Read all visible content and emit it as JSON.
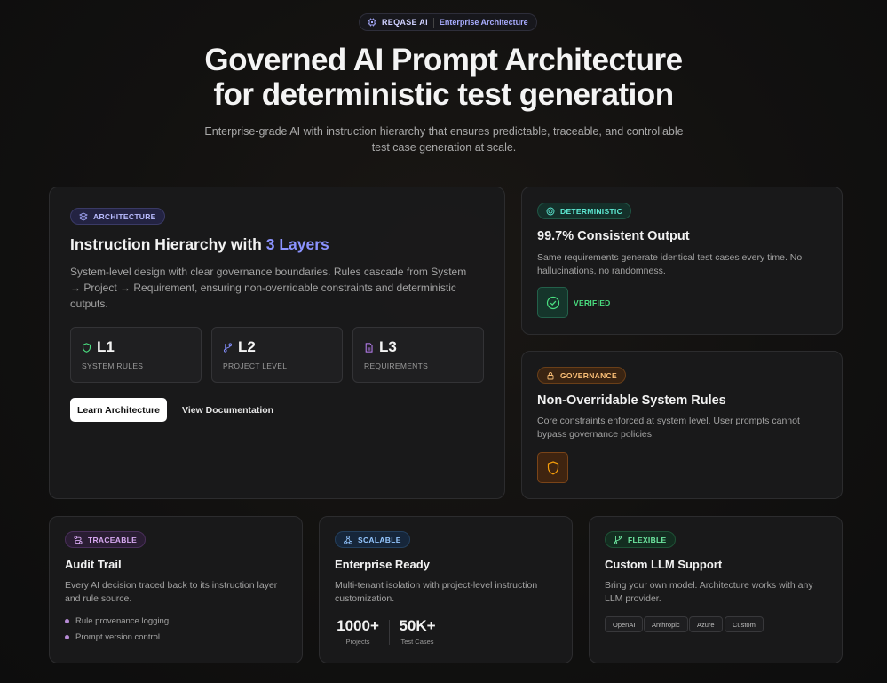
{
  "top_badge": {
    "brand": "REQASE AI",
    "subtitle": "Enterprise Architecture"
  },
  "hero": {
    "title_line1": "Governed AI Prompt Architecture",
    "title_line2": "for deterministic test generation",
    "subtitle": "Enterprise-grade AI with instruction hierarchy that ensures predictable, traceable, and controllable test case generation at scale."
  },
  "architecture_card": {
    "pill": "ARCHITECTURE",
    "title": "Instruction Hierarchy with ",
    "title_accent": "3 Layers",
    "description": "System-level design with clear governance boundaries. Rules cascade from System → Project → Requirement, ensuring non-overridable constraints and deterministic outputs.",
    "layers": [
      {
        "label": "L1",
        "caption": "SYSTEM RULES",
        "icon": "shield-icon",
        "color": "#4ade80"
      },
      {
        "label": "L2",
        "caption": "PROJECT LEVEL",
        "icon": "git-branch-icon",
        "color": "#818cf8"
      },
      {
        "label": "L3",
        "caption": "REQUIREMENTS",
        "icon": "file-icon",
        "color": "#c084fc"
      }
    ],
    "primary_button": "Learn Architecture",
    "secondary_button": "View Documentation"
  },
  "deterministic_card": {
    "pill": "DETERMINISTIC",
    "title": "99.7% Consistent Output",
    "description": "Same requirements generate identical test cases every time. No hallucinations, no randomness.",
    "status": "VERIFIED"
  },
  "governance_card": {
    "pill": "GOVERNANCE",
    "title": "Non-Overridable System Rules",
    "description": "Core constraints enforced at system level. User prompts cannot bypass governance policies."
  },
  "traceable_card": {
    "pill": "TRACEABLE",
    "title": "Audit Trail",
    "description": "Every AI decision traced back to its instruction layer and rule source.",
    "bullets": [
      "Rule provenance logging",
      "Prompt version control"
    ]
  },
  "scalable_card": {
    "pill": "SCALABLE",
    "title": "Enterprise Ready",
    "description": "Multi-tenant isolation with project-level instruction customization.",
    "metrics": [
      {
        "value": "1000+",
        "label": "Projects"
      },
      {
        "value": "50K+",
        "label": "Test Cases"
      }
    ]
  },
  "flexible_card": {
    "pill": "FLEXIBLE",
    "title": "Custom LLM Support",
    "description": "Bring your own model. Architecture works with any LLM provider.",
    "tags": [
      "OpenAI",
      "Anthropic",
      "Azure",
      "Custom"
    ]
  },
  "colors": {
    "accent": "#818cf8",
    "green": "#4ade80",
    "orange": "#f59e0b",
    "purple": "#c084fc",
    "blue": "#7dd3fc",
    "teal": "#5eead4"
  }
}
